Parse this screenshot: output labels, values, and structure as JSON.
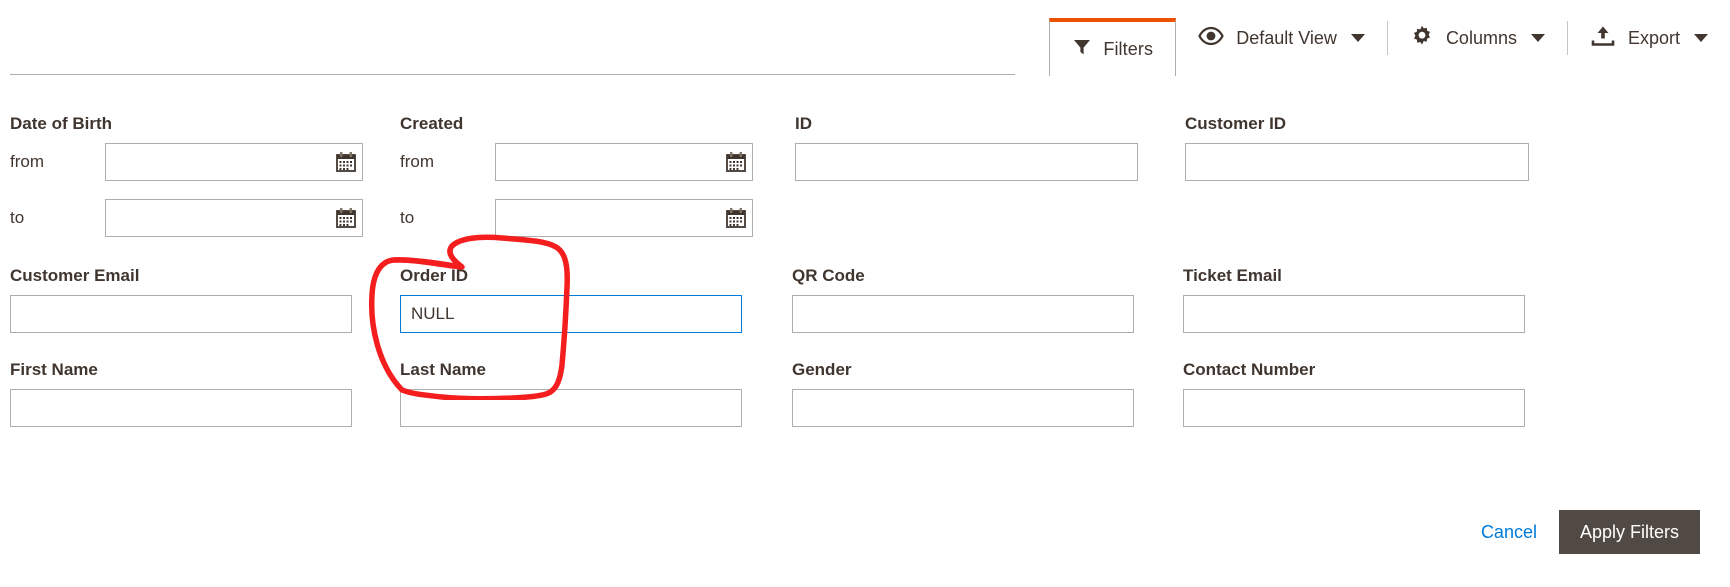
{
  "toolbar": {
    "tabs": [
      {
        "label": "Filters",
        "icon": "funnel-icon",
        "active": true
      }
    ],
    "controls": [
      {
        "label": "Default View",
        "icon": "eye-icon",
        "caret": true
      },
      {
        "label": "Columns",
        "icon": "gear-icon",
        "caret": true
      },
      {
        "label": "Export",
        "icon": "export-icon",
        "caret": true
      }
    ]
  },
  "filters": {
    "date_of_birth": {
      "label": "Date of Birth",
      "from_label": "from",
      "to_label": "to",
      "from_value": "",
      "to_value": "",
      "calendar_icon": "calendar-icon"
    },
    "created": {
      "label": "Created",
      "from_label": "from",
      "to_label": "to",
      "from_value": "",
      "to_value": "",
      "calendar_icon": "calendar-icon"
    },
    "id": {
      "label": "ID",
      "value": ""
    },
    "customer_id": {
      "label": "Customer ID",
      "value": ""
    },
    "customer_email": {
      "label": "Customer Email",
      "value": ""
    },
    "order_id": {
      "label": "Order ID",
      "value": "NULL",
      "focused": true
    },
    "qr_code": {
      "label": "QR Code",
      "value": ""
    },
    "ticket_email": {
      "label": "Ticket Email",
      "value": ""
    },
    "first_name": {
      "label": "First Name",
      "value": ""
    },
    "last_name": {
      "label": "Last Name",
      "value": ""
    },
    "gender": {
      "label": "Gender",
      "value": ""
    },
    "contact_number": {
      "label": "Contact Number",
      "value": ""
    }
  },
  "footer": {
    "cancel_label": "Cancel",
    "apply_label": "Apply Filters"
  },
  "annotation": {
    "shape": "hand-drawn-circle",
    "color": "#f41e1e",
    "target": "order-id-field"
  },
  "colors": {
    "accent_orange": "#eb5202",
    "focus_blue": "#007bdb",
    "link_blue": "#007bdb",
    "button_dark": "#514943",
    "border_gray": "#adadad",
    "text": "#41362f",
    "annotation_red": "#f41e1e"
  }
}
